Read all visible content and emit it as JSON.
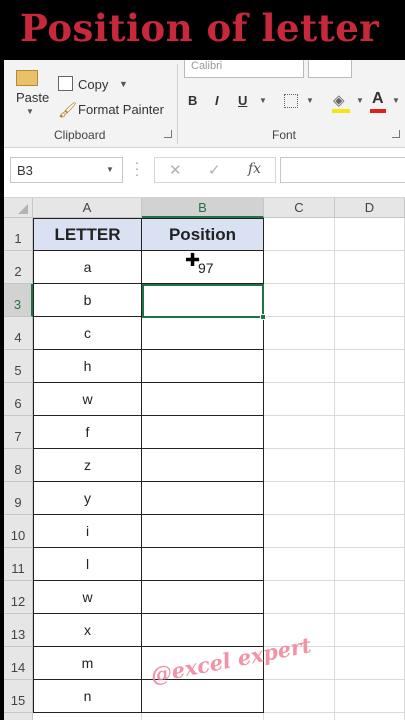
{
  "banner": {
    "title": "Position of letter"
  },
  "ribbon": {
    "clipboard": {
      "paste_label": "Paste",
      "copy_label": "Copy",
      "format_painter_label": "Format Painter",
      "group_label": "Clipboard"
    },
    "font": {
      "font_name": "Calibri",
      "bold_label": "B",
      "italic_label": "I",
      "underline_label": "U",
      "font_color_label": "A",
      "group_label": "Font",
      "fill_color": "#f5e511",
      "font_color": "#e02020"
    }
  },
  "formula_bar": {
    "name_box": "B3",
    "fx_label": "fx",
    "formula": ""
  },
  "grid": {
    "columns": [
      "A",
      "B",
      "C",
      "D"
    ],
    "selected_column": "B",
    "selected_row": "3",
    "header_row": {
      "row": "1",
      "a": "LETTER",
      "b": "Position"
    },
    "rows": [
      {
        "row": "2",
        "a": "a",
        "b": "97"
      },
      {
        "row": "3",
        "a": "b",
        "b": ""
      },
      {
        "row": "4",
        "a": "c",
        "b": ""
      },
      {
        "row": "5",
        "a": "h",
        "b": ""
      },
      {
        "row": "6",
        "a": "w",
        "b": ""
      },
      {
        "row": "7",
        "a": "f",
        "b": ""
      },
      {
        "row": "8",
        "a": "z",
        "b": ""
      },
      {
        "row": "9",
        "a": "y",
        "b": ""
      },
      {
        "row": "10",
        "a": "i",
        "b": ""
      },
      {
        "row": "11",
        "a": "l",
        "b": ""
      },
      {
        "row": "12",
        "a": "w",
        "b": ""
      },
      {
        "row": "13",
        "a": "x",
        "b": ""
      },
      {
        "row": "14",
        "a": "m",
        "b": ""
      },
      {
        "row": "15",
        "a": "n",
        "b": ""
      },
      {
        "row": "16",
        "a": "",
        "b": ""
      }
    ]
  },
  "watermark": "@excel expert",
  "accent_color": "#217346"
}
